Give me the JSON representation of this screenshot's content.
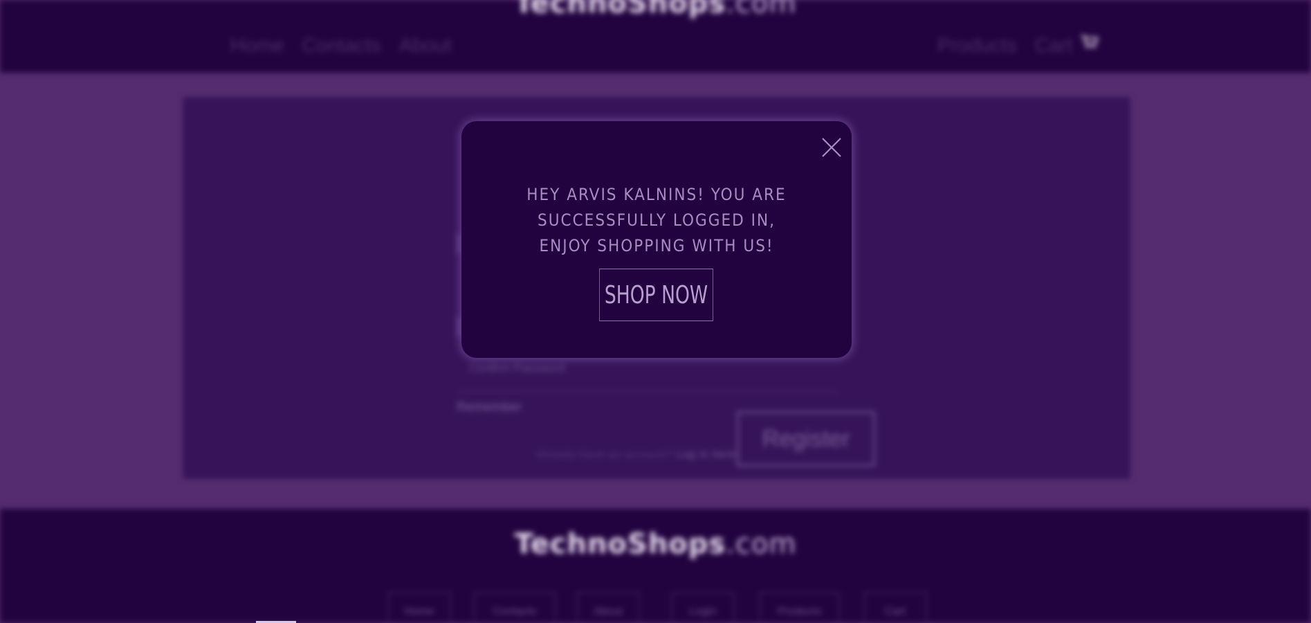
{
  "header": {
    "logo_brand": "TechnoShops",
    "logo_domain": ".com",
    "nav_left": [
      "Home",
      "Contacts",
      "About"
    ],
    "nav_right": [
      "Products",
      "Cart"
    ]
  },
  "main": {
    "form_hint": "Confirm Password",
    "form_label": "Remember",
    "form_small_prefix": "Already have an account?",
    "form_small_link": "Log in here",
    "register_label": "Register"
  },
  "footer": {
    "logo_brand": "TechnoShops",
    "logo_domain": ".com",
    "links": [
      "Home",
      "Contacts",
      "About",
      "Login",
      "Products",
      "Cart"
    ]
  },
  "modal": {
    "message": "Hey Arvis Kalnins! You are successfully logged in, enjoy shopping with us!",
    "shop_now_label": "SHOP NOW",
    "close_icon": "close-icon"
  },
  "colors": {
    "header_bg": "#22033f",
    "page_bg": "#562c70",
    "panel_bg": "#37145a",
    "modal_bg": "#22033f",
    "modal_text": "#a88ec0"
  }
}
